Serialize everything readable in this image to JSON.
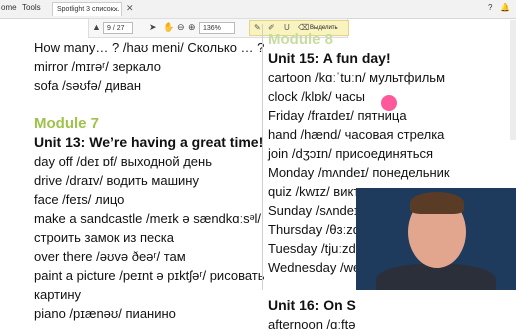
{
  "toolbar": {
    "home_label": "ome",
    "tools_label": "Tools",
    "tab_label": "Spotlight 3 список...",
    "tab_close": "×",
    "page_value": "9 / 27",
    "zoom_value": "136%",
    "highlight_label": "Выделить"
  },
  "left": {
    "lines": [
      "How many… ? /haʊ meni/ Сколько … ?",
      "mirror /mɪrəʳ/ зеркало",
      "sofa /səʊfə/ диван",
      "",
      "Module 7",
      "Unit 13: We’re having a great time!",
      "day off /deɪ ɒf/ выходной день",
      "drive /draɪv/ водить машину",
      "face /feɪs/ лицо",
      "make a sandcastle /meɪk ə sændkɑːsᵊl/",
      "   строить замок из песка",
      "over there /əʊvə ðeəʳ/ там",
      "paint a picture /peɪnt ə pɪktʃəʳ/ рисовать",
      "   картину",
      "piano /pɪænəʊ/ пианино"
    ]
  },
  "right": {
    "lines": [
      "Module 8",
      "Unit 15: A fun day!",
      "cartoon /kɑːˈtuːn/ мультфильм",
      "clock /klɒk/ часы",
      "Friday /fraɪdeɪ/ пятница",
      "hand /hænd/ часовая стрелка",
      "join /dʒɔɪn/ присоединяться",
      "Monday /mʌndeɪ/ понедельник",
      "quiz /kwɪz/ викторина",
      "Sunday /sʌndeɪ/ воскресенье",
      "Thursday /θɜːzdeɪ/",
      "Tuesday /tjuːzdeɪ/",
      "Wednesday /wenzdeɪ/",
      "",
      "Unit 16: On S",
      "afternoon /ɑːftə"
    ]
  },
  "colors": {
    "module_green": "#9fc24a",
    "cursor_pink": "#ff3b8a"
  }
}
